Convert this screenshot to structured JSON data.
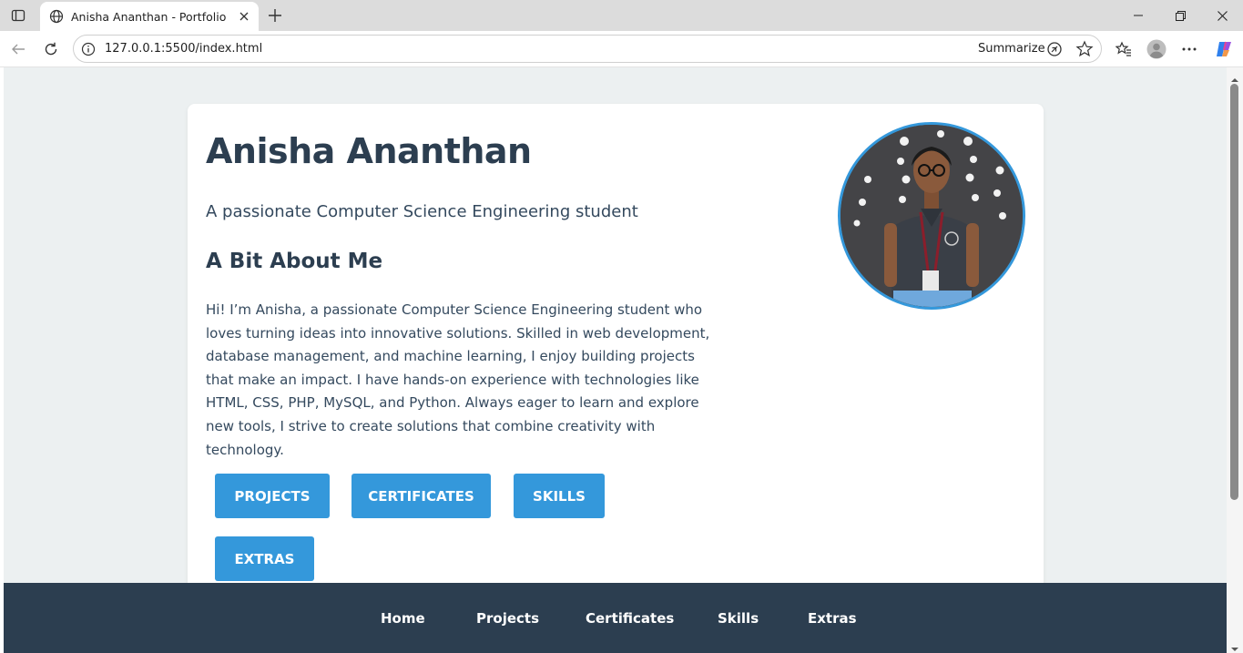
{
  "browser": {
    "tab_title": "Anisha Ananthan - Portfolio",
    "url": "127.0.0.1:5500/index.html",
    "summarize_label": "Summarize"
  },
  "profile": {
    "name": "Anisha Ananthan",
    "tagline": "A passionate Computer Science Engineering student",
    "about_heading": "A Bit About Me",
    "about_text": "Hi! I’m Anisha, a passionate Computer Science Engineering student who loves turning ideas into innovative solutions. Skilled in web development, database management, and machine learning, I enjoy building projects that make an impact. I have hands-on experience with technologies like HTML, CSS, PHP, MySQL, and Python. Always eager to learn and explore new tools, I strive to create solutions that combine creativity with technology."
  },
  "buttons": {
    "projects": "PROJECTS",
    "certificates": "CERTIFICATES",
    "skills": "SKILLS",
    "extras": "EXTRAS"
  },
  "footer_nav": {
    "home": "Home",
    "projects": "Projects",
    "certificates": "Certificates",
    "skills": "Skills",
    "extras": "Extras"
  },
  "colors": {
    "accent": "#3498db",
    "heading": "#2c3e50",
    "page_bg": "#ecf0f1",
    "footer_bg": "#2c3e50"
  }
}
